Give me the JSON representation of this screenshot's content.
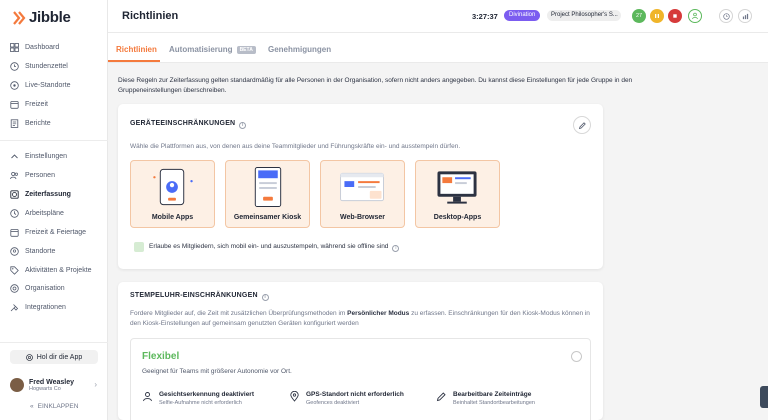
{
  "app": {
    "logo_text": "Jibble"
  },
  "sidebar": {
    "items": [
      {
        "label": "Dashboard",
        "icon": "dashboard-icon"
      },
      {
        "label": "Stundenzettel",
        "icon": "timesheet-icon"
      },
      {
        "label": "Live-Standorte",
        "icon": "location-icon"
      },
      {
        "label": "Freizeit",
        "icon": "timeoff-icon"
      },
      {
        "label": "Berichte",
        "icon": "reports-icon"
      },
      {
        "label": "Einstellungen",
        "icon": "chevron-up-icon"
      },
      {
        "label": "Personen",
        "icon": "people-icon"
      },
      {
        "label": "Zeiterfassung",
        "icon": "timetracking-icon"
      },
      {
        "label": "Arbeitspläne",
        "icon": "schedule-icon"
      },
      {
        "label": "Freizeit & Feiertage",
        "icon": "holiday-icon"
      },
      {
        "label": "Standorte",
        "icon": "pin-icon"
      },
      {
        "label": "Aktivitäten & Projekte",
        "icon": "tag-icon"
      },
      {
        "label": "Organisation",
        "icon": "org-icon"
      },
      {
        "label": "Integrationen",
        "icon": "integrations-icon"
      }
    ],
    "help_label": "Hol dir die App",
    "user": {
      "name": "Fred Weasley",
      "org": "Hogwarts Co"
    },
    "collapse_label": "EINKLAPPEN"
  },
  "header": {
    "title": "Richtlinien",
    "timer": "3:27:37",
    "activity_tag": "Divination",
    "project_tag": "Project Philosopher's S...",
    "status_badge": "27"
  },
  "tabs": [
    {
      "label": "Richtlinien",
      "active": true
    },
    {
      "label": "Automatisierung",
      "badge": "BETA"
    },
    {
      "label": "Genehmigungen"
    }
  ],
  "intro_text": "Diese Regeln zur Zeiterfassung gelten standardmäßig für alle Personen in der Organisation, sofern nicht anders angegeben. Du kannst diese Einstellungen für jede Gruppe in den Gruppeneinstellungen überschreiben.",
  "device_card": {
    "title": "GERÄTEEINSCHRÄNKUNGEN",
    "description": "Wähle die Plattformen aus, von denen aus deine Teammitglieder und Führungskräfte ein- und ausstempeln dürfen.",
    "platforms": [
      "Mobile Apps",
      "Gemeinsamer Kiosk",
      "Web-Browser",
      "Desktop-Apps"
    ],
    "offline_label": "Erlaube es Mitgliedern, sich mobil ein- und auszustempeln, während sie offline sind"
  },
  "clock_card": {
    "title": "STEMPELUHR-EINSCHRÄNKUNGEN",
    "description_pre": "Fordere Mitglieder auf, die Zeit mit zusätzlichen Überprüfungsmethoden im ",
    "description_bold": "Persönlicher Modus",
    "description_post": " zu erfassen. Einschränkungen für den Kiosk-Modus können in den Kiosk-Einstellungen auf gemeinsam genutzten Geräten konfiguriert werden",
    "mode_title": "Flexibel",
    "mode_sub": "Geeignet für Teams mit größerer Autonomie vor Ort.",
    "features": [
      {
        "title": "Gesichtserkennung deaktiviert",
        "sub": "Selfie-Aufnahme nicht erforderlich",
        "icon": "person-icon"
      },
      {
        "title": "GPS-Standort nicht erforderlich",
        "sub": "Geofences deaktiviert",
        "icon": "location-pin-icon"
      },
      {
        "title": "Bearbeitbare Zeiteinträge",
        "sub": "Beinhaltet Standortbearbeitungen",
        "icon": "edit-entry-icon"
      }
    ]
  },
  "colors": {
    "accent": "#f47a3d",
    "green": "#5cb85c",
    "purple": "#7b5cf0"
  }
}
